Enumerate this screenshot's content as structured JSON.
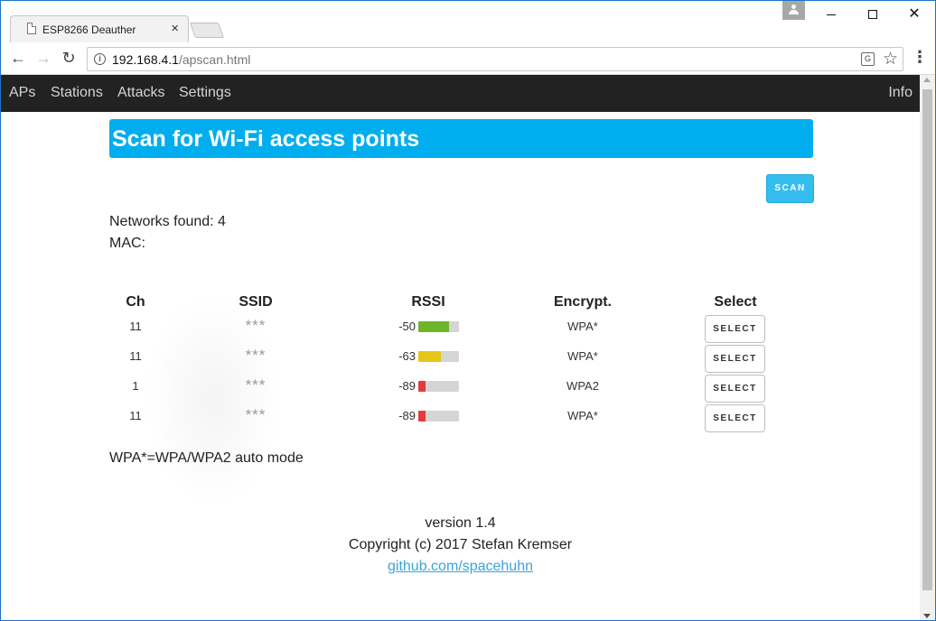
{
  "browser": {
    "tab_title": "ESP8266 Deauther",
    "tab_close": "×",
    "url_host": "192.168.4.1",
    "url_path": "/apscan.html",
    "info_glyph": "i"
  },
  "site": {
    "nav": [
      "APs",
      "Stations",
      "Attacks",
      "Settings"
    ],
    "nav_right": "Info",
    "banner_title": "Scan for Wi-Fi access points",
    "scan_label": "SCAN",
    "networks_found": "Networks found: 4",
    "mac": "MAC:",
    "columns": [
      "Ch",
      "SSID",
      "RSSI",
      "Encrypt.",
      "Select"
    ],
    "rows": [
      {
        "ch": "11",
        "ssid": "***",
        "rssi": "-50",
        "signal_fraction": 0.75,
        "bar_color": "#6fb52c",
        "enc": "WPA*",
        "select": "SELECT"
      },
      {
        "ch": "11",
        "ssid": "***",
        "rssi": "-63",
        "signal_fraction": 0.55,
        "bar_color": "#e6c619",
        "enc": "WPA*",
        "select": "SELECT"
      },
      {
        "ch": "1",
        "ssid": "***",
        "rssi": "-89",
        "signal_fraction": 0.18,
        "bar_color": "#e33b3b",
        "enc": "WPA2",
        "select": "SELECT"
      },
      {
        "ch": "11",
        "ssid": "***",
        "rssi": "-89",
        "signal_fraction": 0.18,
        "bar_color": "#e33b3b",
        "enc": "WPA*",
        "select": "SELECT"
      }
    ],
    "note": "WPA*=WPA/WPA2 auto mode",
    "version": "version 1.4",
    "copyright": "Copyright (c) 2017 Stefan Kremser",
    "link": "github.com/spacehuhn"
  },
  "colors": {
    "accent": "#00adee",
    "nav_bg": "#222222",
    "link": "#3aa3d8"
  },
  "icons": [
    "document-icon",
    "close-icon",
    "user-icon",
    "minimize-icon",
    "maximize-icon",
    "window-close-icon",
    "back-arrow-icon",
    "forward-arrow-icon",
    "reload-icon",
    "info-icon",
    "translate-icon",
    "star-icon",
    "menu-icon"
  ]
}
